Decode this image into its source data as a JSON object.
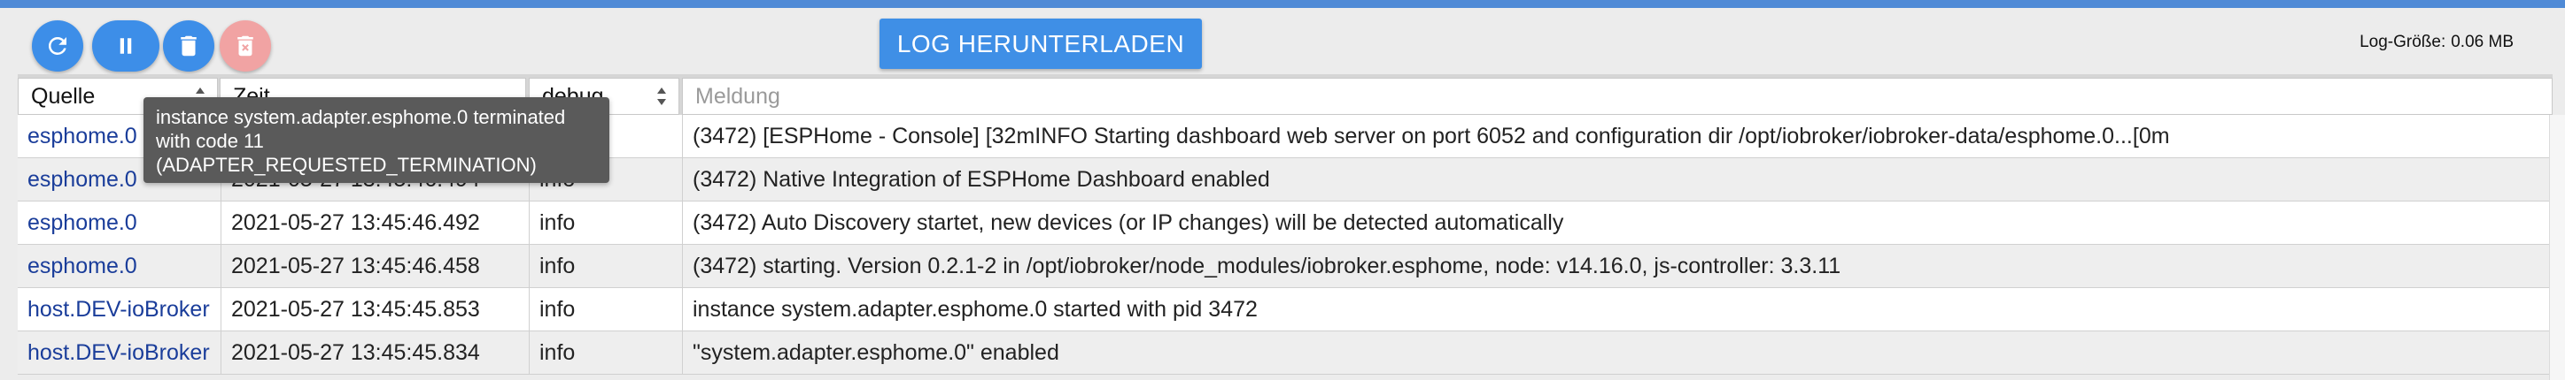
{
  "toolbar": {
    "buttons": [
      {
        "name": "refresh-button",
        "icon": "refresh-icon"
      },
      {
        "name": "pause-button",
        "icon": "pause-icon"
      },
      {
        "name": "clear-log-button",
        "icon": "trash-icon"
      },
      {
        "name": "delete-log-file-button",
        "icon": "trash-x-icon",
        "disabled": true
      }
    ],
    "download_label": "LOG HERUNTERLADEN",
    "log_size_label": "Log-Größe:",
    "log_size_value": "0.06 MB"
  },
  "filters": {
    "source_value": "Quelle",
    "time_value": "Zeit",
    "severity_value": "debug",
    "message_placeholder": "Meldung"
  },
  "log_rows": [
    {
      "source": "esphome.0",
      "time": "",
      "severity": "",
      "message": "(3472) [ESPHome - Console] [32mINFO Starting dashboard web server on port 6052 and configuration dir /opt/iobroker/iobroker-data/esphome.0...[0m"
    },
    {
      "source": "esphome.0",
      "time": "2021-05-27 13:45:46.494",
      "severity": "info",
      "message": "(3472) Native Integration of ESPHome Dashboard enabled"
    },
    {
      "source": "esphome.0",
      "time": "2021-05-27 13:45:46.492",
      "severity": "info",
      "message": "(3472) Auto Discovery startet, new devices (or IP changes) will be detected automatically"
    },
    {
      "source": "esphome.0",
      "time": "2021-05-27 13:45:46.458",
      "severity": "info",
      "message": "(3472) starting. Version 0.2.1-2 in /opt/iobroker/node_modules/iobroker.esphome, node: v14.16.0, js-controller: 3.3.11"
    },
    {
      "source": "host.DEV-ioBroker",
      "time": "2021-05-27 13:45:45.853",
      "severity": "info",
      "message": "instance system.adapter.esphome.0 started with pid 3472"
    },
    {
      "source": "host.DEV-ioBroker",
      "time": "2021-05-27 13:45:45.834",
      "severity": "info",
      "message": "\"system.adapter.esphome.0\" enabled"
    }
  ],
  "tooltip": {
    "line1": "instance system.adapter.esphome.0 terminated",
    "line2": "with code 11",
    "line3": "(ADAPTER_REQUESTED_TERMINATION)"
  },
  "colors": {
    "accent": "#3d8ee8",
    "disabled_button": "#f1a3a3",
    "source_link": "#1a3d9a",
    "topbar": "#4f8ad6"
  }
}
